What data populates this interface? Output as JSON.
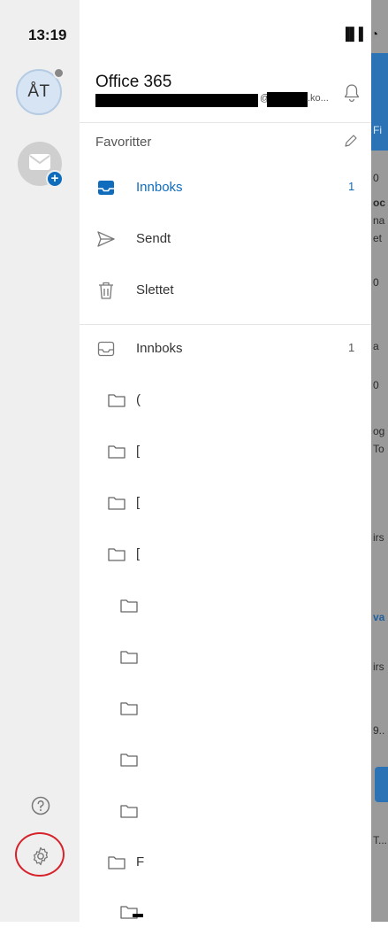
{
  "status_bar": {
    "time": "13:19",
    "icons": "▐▌▌ ◔"
  },
  "rail": {
    "avatar_initials": "ÅT",
    "add_account_badge": "+"
  },
  "drawer": {
    "account_name": "Office 365",
    "email_suffix_a": "@",
    "email_suffix_b": ".ko...",
    "favorites_label": "Favoritter",
    "favorites": [
      {
        "label": "Innboks",
        "count": "1",
        "icon": "inbox-icon"
      },
      {
        "label": "Sendt",
        "count": "",
        "icon": "send-icon"
      },
      {
        "label": "Slettet",
        "count": "",
        "icon": "trash-icon"
      }
    ],
    "folders": [
      {
        "label": "Innboks",
        "count": "1",
        "icon": "inbox-icon"
      },
      {
        "label": "(",
        "count": "",
        "icon": "folder-icon"
      },
      {
        "label": "[",
        "count": "",
        "icon": "folder-icon"
      },
      {
        "label": "[",
        "count": "",
        "icon": "folder-icon"
      },
      {
        "label": "[",
        "count": "",
        "icon": "folder-icon"
      },
      {
        "label": "",
        "count": "",
        "icon": "folder-icon"
      },
      {
        "label": "",
        "count": "",
        "icon": "folder-icon"
      },
      {
        "label": "",
        "count": "",
        "icon": "folder-icon"
      },
      {
        "label": "",
        "count": "",
        "icon": "folder-icon"
      },
      {
        "label": "",
        "count": "",
        "icon": "folder-icon"
      },
      {
        "label": "F",
        "count": "",
        "icon": "folder-icon"
      },
      {
        "label": "",
        "count": "",
        "icon": "folder-icon"
      }
    ]
  },
  "overlay": {
    "header_text": "Fi",
    "snippets": [
      "0",
      "oc",
      "na",
      "et",
      "0",
      "a",
      "0",
      "og",
      "To",
      "irs",
      "va",
      "irs",
      "9..",
      "T..."
    ]
  },
  "colors": {
    "accent": "#0f6cbd",
    "rail_bg": "#efefef",
    "highlight_circle": "#d6222a"
  }
}
